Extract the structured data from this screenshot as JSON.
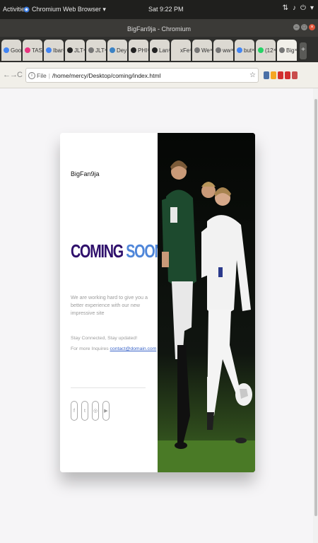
{
  "os_topbar": {
    "activities": "Activities",
    "app_name": "Chromium Web Browser ▾",
    "clock": "Sat 9:22 PM",
    "tray_icons": [
      "network-icon",
      "sound-icon",
      "power-icon",
      "menu-down-icon"
    ]
  },
  "window": {
    "title": "BigFan9ja - Chromium"
  },
  "tabs": [
    {
      "label": "Goo",
      "favicon": "#4285f4",
      "active": false
    },
    {
      "label": "TAS",
      "favicon": "#e8347f",
      "active": false
    },
    {
      "label": "Ibar",
      "favicon": "#4285f4",
      "active": false
    },
    {
      "label": "JLT",
      "favicon": "#222222",
      "active": false
    },
    {
      "label": "JLT",
      "favicon": "#777777",
      "active": false
    },
    {
      "label": "Dey",
      "favicon": "#3b82c4",
      "active": false
    },
    {
      "label": "PHI",
      "favicon": "#222222",
      "active": false
    },
    {
      "label": "Lan",
      "favicon": "#222222",
      "active": false
    },
    {
      "label": "xFe",
      "favicon": "#dcd9d2",
      "active": false
    },
    {
      "label": "We",
      "favicon": "#777777",
      "active": false
    },
    {
      "label": "ww",
      "favicon": "#777777",
      "active": false
    },
    {
      "label": "but",
      "favicon": "#4285f4",
      "active": false
    },
    {
      "label": "(12",
      "favicon": "#25d366",
      "active": false
    },
    {
      "label": "Big",
      "favicon": "#777777",
      "active": true
    }
  ],
  "toolbar": {
    "back": "←",
    "forward": "→",
    "reload": "C",
    "info": "i",
    "scheme": "File",
    "separator": "|",
    "url": "/home/mercy/Desktop/coming/index.html",
    "star": "☆"
  },
  "extensions": [
    "#4a6fa5",
    "#f5a623",
    "#d22f2f",
    "#d22f2f",
    "#c94c4c"
  ],
  "page": {
    "brand": "BigFan9ja",
    "headline_word1": "COMING",
    "headline_word2": "SOON...",
    "description": "We are working hard to give you a better experience with our new impressive site",
    "contact_line1": "Stay Connected, Stay updated!",
    "contact_line2_prefix": "For more Inquires",
    "contact_email": "contact@domain.com",
    "social": [
      {
        "icon": "facebook-icon",
        "glyph": "f"
      },
      {
        "icon": "twitter-icon",
        "glyph": "t"
      },
      {
        "icon": "instagram-icon",
        "glyph": "◎"
      },
      {
        "icon": "youtube-icon",
        "glyph": "▶"
      }
    ],
    "photo": "soccer-players-photo"
  }
}
